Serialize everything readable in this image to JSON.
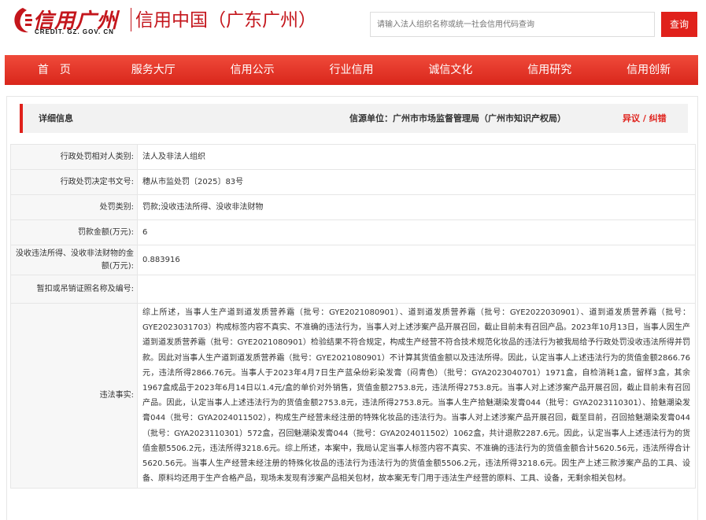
{
  "header": {
    "logo_text": "信用广州",
    "logo_sub": "CREDIT. GZ. GOV. CN",
    "site_name": "信用中国（广东广州）",
    "search_placeholder": "请输入法人组织名称或统一社会信用代码查询",
    "search_button": "查询"
  },
  "nav": {
    "items": [
      "首　页",
      "服务大厅",
      "信用公示",
      "行业信用",
      "诚信文化",
      "信用研究",
      "信用创新"
    ]
  },
  "detail": {
    "title": "详细信息",
    "source": "信源单位：广州市市场监督管理局（广州市知识产权局）",
    "objection": "异议 / 纠错"
  },
  "rows": [
    {
      "label": "行政处罚相对人类别:",
      "value": "法人及非法人组织"
    },
    {
      "label": "行政处罚决定书文号:",
      "value": "穗从市监处罚〔2025〕83号"
    },
    {
      "label": "处罚类别:",
      "value": "罚款;没收违法所得、没收非法财物"
    },
    {
      "label": "罚款金额(万元):",
      "value": "6"
    },
    {
      "label": "没收违法所得、没收非法财物的金额(万元):",
      "value": "0.883916"
    },
    {
      "label": "暂扣或吊销证照名称及编号:",
      "value": ""
    }
  ],
  "facts": {
    "label": "违法事实:",
    "text": "综上所述，当事人生产道到道发质营养霜（批号：GYE2021080901）、道到道发质营养霜（批号：GYE2022030901）、道到道发质营养霜（批号：GYE2023031703）构成标签内容不真实、不准确的违法行为，当事人对上述涉案产品开展召回，截止目前未有召回产品。2023年10月13日，当事人因生产道到道发质营养霜（批号：GYE2021080901）检验结果不符合规定，构成生产经营不符合技术规范化妆品的违法行为被我局给予行政处罚没收违法所得并罚款。因此对当事人生产道到道发质营养霜（批号：GYE2021080901）不计算其货值金额以及违法所得。因此，认定当事人上述违法行为的货值金额2866.76元，违法所得2866.76元。当事人于2023年4月7日生产蓝朵纷彩染发膏（闷青色）（批号：GYA2023040701）1971盒，自检消耗1盒，留样3盒，其余1967盒成品于2023年6月14日以1.4元/盒的单价对外销售，货值金额2753.8元，违法所得2753.8元。当事人对上述涉案产品开展召回，截止目前未有召回产品。因此，认定当事人上述违法行为的货值金额2753.8元，违法所得2753.8元。当事人生产拾魅潮染发膏044（批号：GYA2023110301）、拾魅潮染发膏044（批号：GYA2024011502），构成生产经营未经注册的特殊化妆品的违法行为。当事人对上述涉案产品开展召回，截至目前，召回拾魅潮染发膏044（批号：GYA2023110301）572盒，召回魅潮染发膏044（批号：GYA2024011502）1062盒，共计退款2287.6元。因此，认定当事人上述违法行为的货值金额5506.2元，违法所得3218.6元。综上所述，本案中，我局认定当事人标签内容不真实、不准确的违法行为的货值金额合计5620.56元，违法所得合计5620.56元。当事人生产经营未经注册的特殊化妆品的违法行为违法行为的货值金额5506.2元，违法所得3218.6元。因生产上述三款涉案产品的工具、设备、原料均还用于生产合格产品，现场未发现有涉案产品相关包材，故本案无专门用于违法生产经营的原料、工具、设备，无剩余相关包材。"
  },
  "colors": {
    "brand_red": "#e0211b",
    "nav_red": "#e33a2c"
  }
}
